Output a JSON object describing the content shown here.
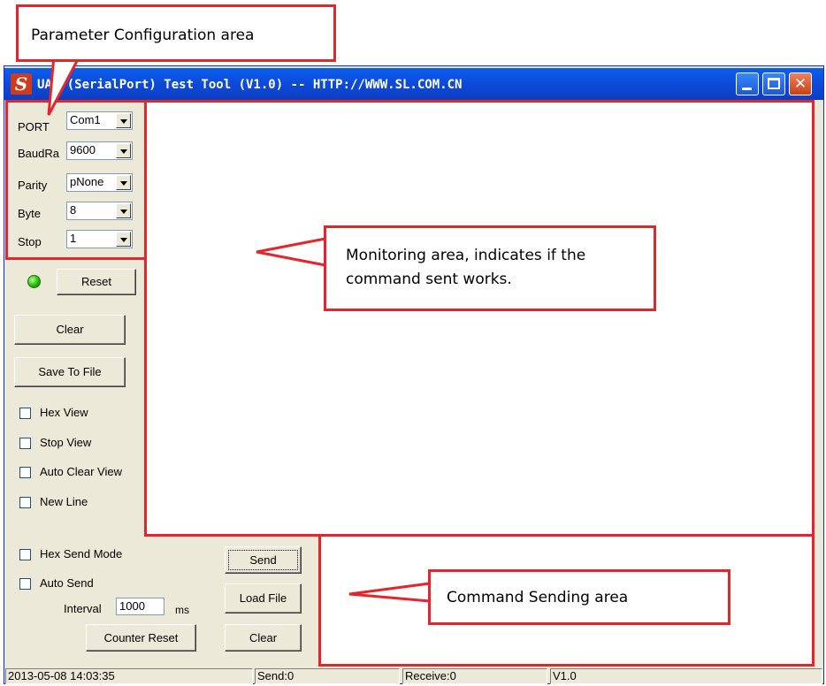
{
  "annotations": {
    "param_config": "Parameter Configuration area",
    "monitoring": "Monitoring area, indicates if the command sent works.",
    "command_sending": "Command Sending area"
  },
  "window": {
    "title": "UART(SerialPort) Test Tool (V1.0) -- HTTP://WWW.SL.COM.CN",
    "logo_letter": "S"
  },
  "params": [
    {
      "label": "PORT",
      "value": "Com1"
    },
    {
      "label": "BaudRa",
      "value": "9600"
    },
    {
      "label": "Parity",
      "value": "pNone"
    },
    {
      "label": "Byte",
      "value": "8"
    },
    {
      "label": "Stop",
      "value": "1"
    }
  ],
  "buttons": {
    "reset": "Reset",
    "clear": "Clear",
    "save_to_file": "Save To File",
    "send": "Send",
    "load_file": "Load File",
    "clear_send": "Clear",
    "counter_reset": "Counter Reset"
  },
  "view_options": [
    "Hex View",
    "Stop View",
    "Auto Clear View",
    "New Line"
  ],
  "send_options": {
    "hex_send_mode": "Hex Send Mode",
    "auto_send": "Auto Send",
    "interval_label": "Interval",
    "interval_value": "1000",
    "interval_unit": "ms"
  },
  "statusbar": {
    "datetime": "2013-05-08 14:03:35",
    "send": "Send:0",
    "receive": "Receive:0",
    "version": "V1.0"
  },
  "colors": {
    "annotation_red": "#e6252a",
    "titlebar_blue": "#0a5ff0",
    "led_green": "#1fbf06"
  }
}
